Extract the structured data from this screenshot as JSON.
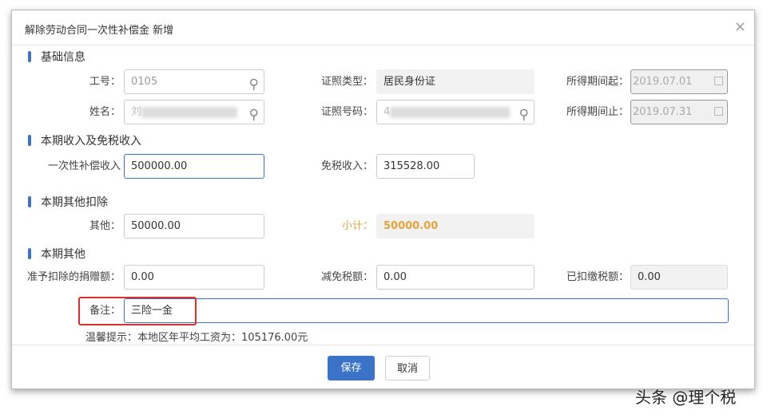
{
  "dialog": {
    "title": "解除劳动合同一次性补偿金 新增",
    "close": "×"
  },
  "sections": {
    "basic": "基础信息",
    "income": "本期收入及免税收入",
    "deduct": "本期其他扣除",
    "other": "本期其他"
  },
  "basic": {
    "emp_no_label": "工号：",
    "emp_no": "0105",
    "name_label": "姓名：",
    "name_prefix": "刘",
    "id_type_label": "证照类型：",
    "id_type": "居民身份证",
    "id_no_label": "证照号码：",
    "id_no_prefix": "4",
    "period_start_label": "所得期间起：",
    "period_start": "2019.07.01",
    "period_end_label": "所得期间止：",
    "period_end": "2019.07.31"
  },
  "income": {
    "comp_label": "一次性补偿收入",
    "comp": "500000.00",
    "taxfree_label": "免税收入：",
    "taxfree": "315528.00"
  },
  "deduct": {
    "other_label": "其他：",
    "other": "50000.00",
    "subtotal_label": "小计：",
    "subtotal": "50000.00"
  },
  "other": {
    "donation_label": "准予扣除的捐赠额：",
    "donation": "0.00",
    "relief_label": "减免税额：",
    "relief": "0.00",
    "withheld_label": "已扣缴税额：",
    "withheld": "0.00",
    "remark_label": "备注：",
    "remark": "三险一金"
  },
  "tip": "温馨提示：本地区年平均工资为：105176.00元",
  "buttons": {
    "save": "保存",
    "cancel": "取消"
  },
  "watermark": "头条 @理个税",
  "colors": {
    "accent": "#3b73c9",
    "subtotal": "#e8a33b",
    "highlight": "#d9302c"
  }
}
